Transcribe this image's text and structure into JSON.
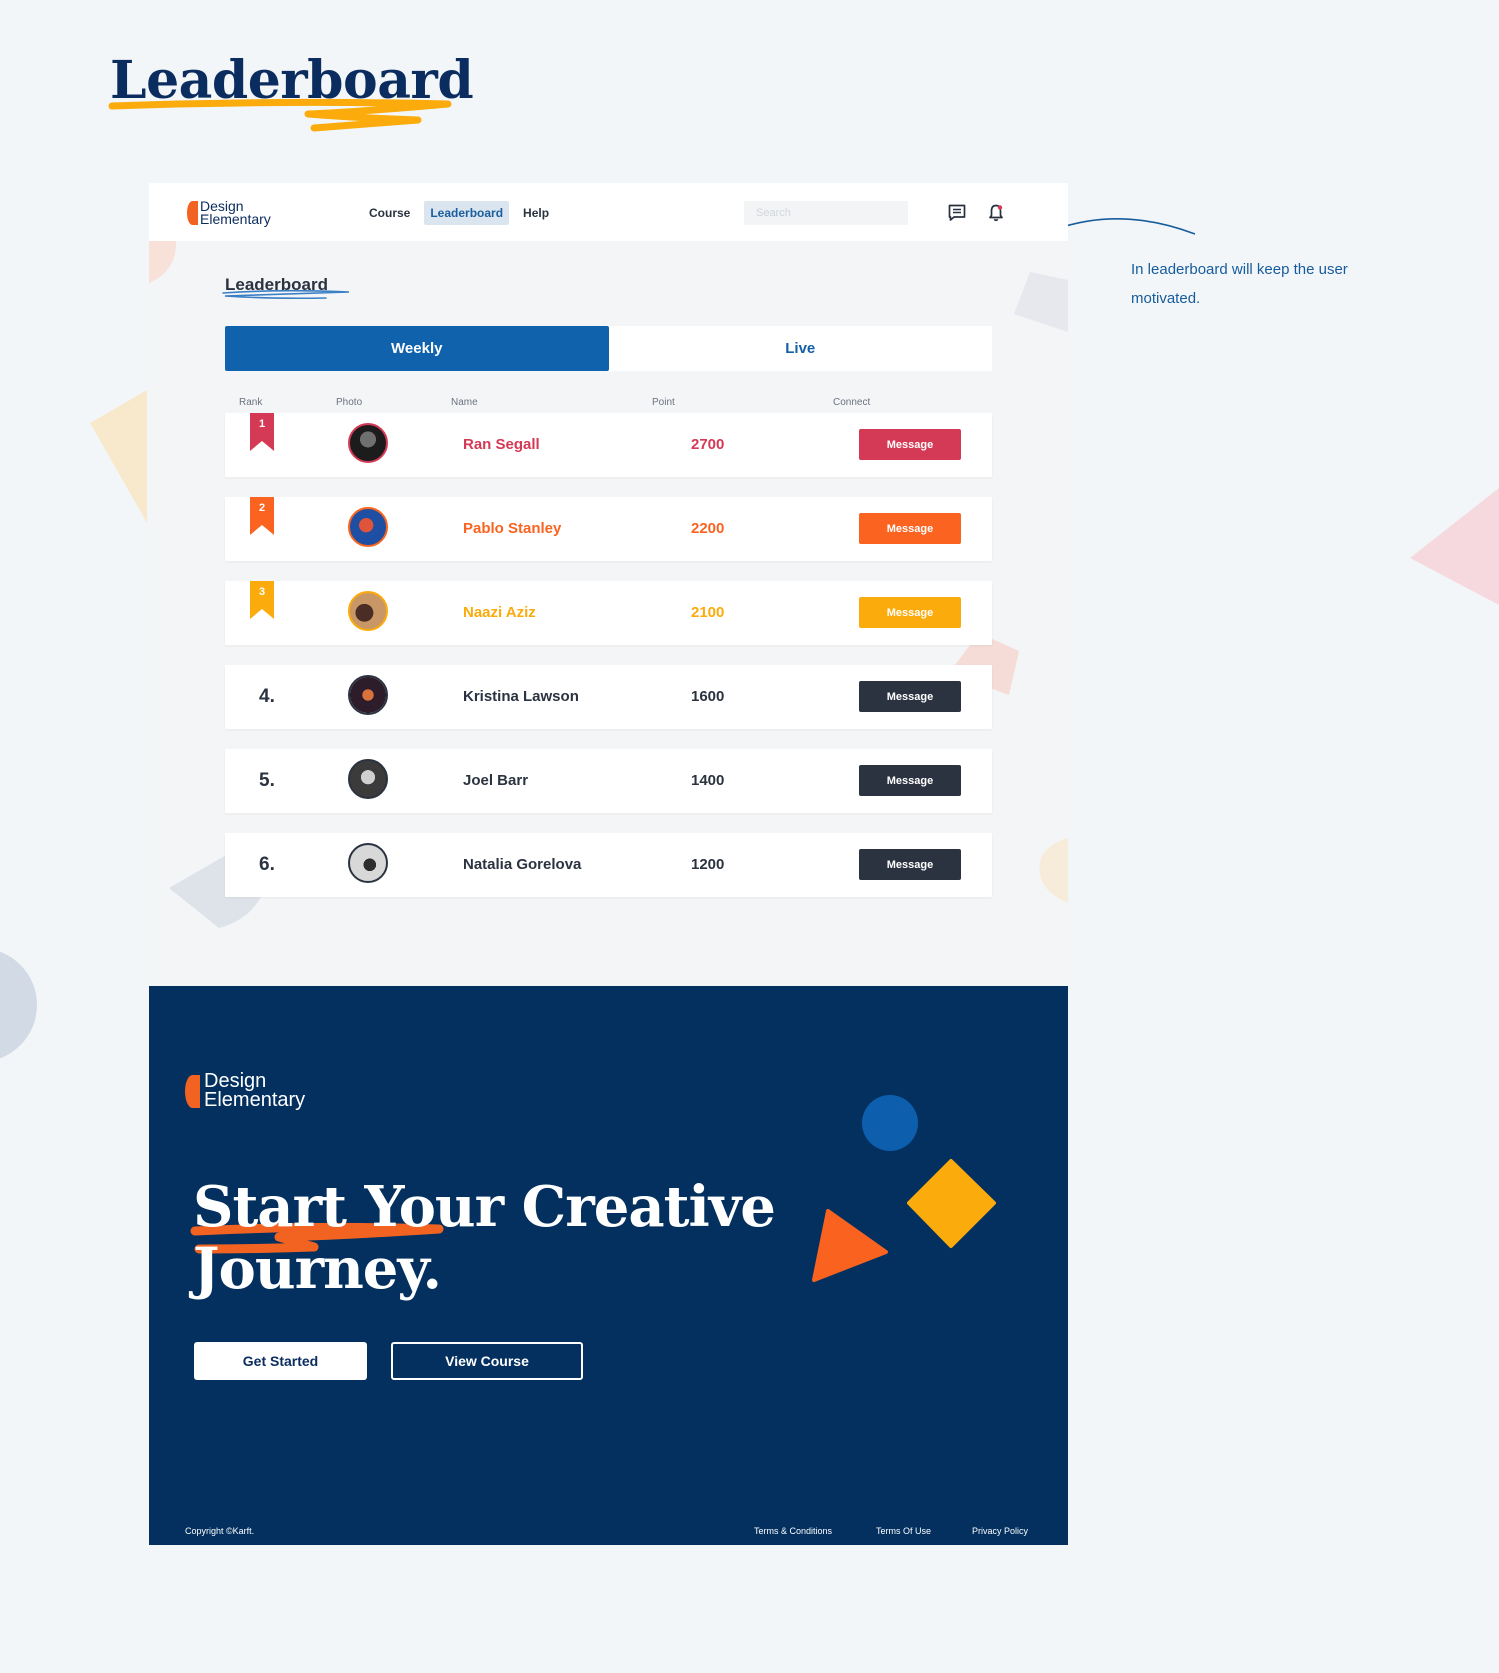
{
  "page_title": "Leaderboard",
  "annotation": "In leaderboard will keep the user motivated.",
  "brand": {
    "line1": "Design",
    "line2": "Elementary"
  },
  "nav": {
    "items": [
      "Course",
      "Leaderboard",
      "Help"
    ],
    "active": "Leaderboard"
  },
  "search": {
    "placeholder": "Search",
    "value": ""
  },
  "icons": {
    "messages": "message-icon",
    "notifications": "bell-icon"
  },
  "content": {
    "title": "Leaderboard",
    "tabs": [
      {
        "label": "Weekly",
        "active": true
      },
      {
        "label": "Live",
        "active": false
      }
    ],
    "columns": [
      "Rank",
      "Photo",
      "Name",
      "Point",
      "Connect"
    ],
    "rows": [
      {
        "rank": "1",
        "rank_style": "ribbon",
        "name": "Ran Segall",
        "points": "2700",
        "action": "Message",
        "color": "#d43a55"
      },
      {
        "rank": "2",
        "rank_style": "ribbon",
        "name": "Pablo Stanley",
        "points": "2200",
        "action": "Message",
        "color": "#fa6320"
      },
      {
        "rank": "3",
        "rank_style": "ribbon",
        "name": "Naazi Aziz",
        "points": "2100",
        "action": "Message",
        "color": "#fbab0b"
      },
      {
        "rank": "4.",
        "rank_style": "number",
        "name": "Kristina Lawson",
        "points": "1600",
        "action": "Message",
        "color": "#2b3340"
      },
      {
        "rank": "5.",
        "rank_style": "number",
        "name": "Joel Barr",
        "points": "1400",
        "action": "Message",
        "color": "#2b3340"
      },
      {
        "rank": "6.",
        "rank_style": "number",
        "name": "Natalia Gorelova",
        "points": "1200",
        "action": "Message",
        "color": "#2b3340"
      }
    ]
  },
  "footer": {
    "brand": {
      "line1": "Design",
      "line2": "Elementary"
    },
    "hero_line1": "Start Your Creative",
    "hero_line2": "Journey.",
    "primary_button": "Get Started",
    "secondary_button": "View Course",
    "copyright": "Copyright ©Karft.",
    "links": [
      "Terms & Conditions",
      "Terms Of Use",
      "Privacy Policy"
    ]
  },
  "colors": {
    "brand_blue": "#0f62ab",
    "navy": "#03305f",
    "orange": "#f26322",
    "yellow": "#fbab0b",
    "red": "#d43a55"
  }
}
